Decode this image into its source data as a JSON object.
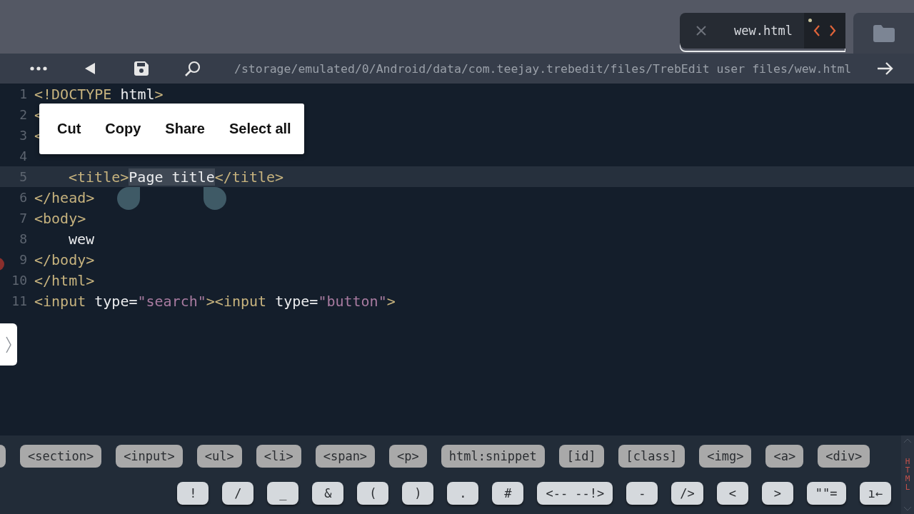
{
  "tab": {
    "filename": "wew.html",
    "modified": true,
    "selected": true
  },
  "toolbar": {
    "path": "/storage/emulated/0/Android/data/com.teejay.trebedit/files/TrebEdit user files/wew.html"
  },
  "lines": [
    {
      "number": "1",
      "current": false,
      "indented": false,
      "tokens": [
        {
          "kind": "tag",
          "text": "<!DOCTYPE"
        },
        {
          "kind": "text",
          "text": " html"
        },
        {
          "kind": "tag",
          "text": ">"
        }
      ]
    },
    {
      "number": "2",
      "current": false,
      "indented": false,
      "tokens": [
        {
          "kind": "tag",
          "text": "<"
        }
      ]
    },
    {
      "number": "3",
      "current": false,
      "indented": false,
      "tokens": [
        {
          "kind": "tag",
          "text": "<"
        }
      ]
    },
    {
      "number": "4",
      "current": false
    },
    {
      "number": "5",
      "current": true,
      "indented": true,
      "tokens": [
        {
          "kind": "tag",
          "text": "<title>"
        },
        {
          "kind": "text",
          "text": "Page title",
          "selected": true
        },
        {
          "kind": "tag",
          "text": "</title>"
        }
      ]
    },
    {
      "number": "6",
      "current": false,
      "indented": false,
      "tokens": [
        {
          "kind": "tag",
          "text": "</head>"
        }
      ]
    },
    {
      "number": "7",
      "current": false,
      "indented": false,
      "tokens": [
        {
          "kind": "tag",
          "text": "<body>"
        }
      ]
    },
    {
      "number": "8",
      "current": false,
      "indented": true,
      "tokens": [
        {
          "kind": "text",
          "text": "wew"
        }
      ]
    },
    {
      "number": "9",
      "current": false,
      "indented": false,
      "tokens": [
        {
          "kind": "tag",
          "text": "</body>"
        }
      ]
    },
    {
      "number": "10",
      "current": false,
      "indented": false,
      "tokens": [
        {
          "kind": "tag",
          "text": "</html>"
        }
      ]
    },
    {
      "number": "11",
      "current": false,
      "indented": false,
      "tokens": [
        {
          "kind": "tag",
          "text": "<input"
        },
        {
          "kind": "text",
          "text": " type="
        },
        {
          "kind": "string",
          "text": "\"search\""
        },
        {
          "kind": "tag",
          "text": "><input"
        },
        {
          "kind": "text",
          "text": " type="
        },
        {
          "kind": "string",
          "text": "\"button\""
        },
        {
          "kind": "tag",
          "text": ">"
        }
      ]
    }
  ],
  "context_menu": [
    "Cut",
    "Copy",
    "Share",
    "Select all"
  ],
  "snippets": [
    "<section>",
    "<input>",
    "<ul>",
    "<li>",
    "<span>",
    "<p>",
    "html:snippet",
    "[id]",
    "[class]",
    "<img>",
    "<a>",
    "<div>"
  ],
  "symbols": [
    "!",
    "/",
    "_",
    "&",
    "(",
    ")",
    ".",
    "#",
    "<-- --!>",
    "-",
    "/>",
    "<",
    ">",
    "\"\"=",
    "ı←"
  ],
  "side_label": "HTML"
}
